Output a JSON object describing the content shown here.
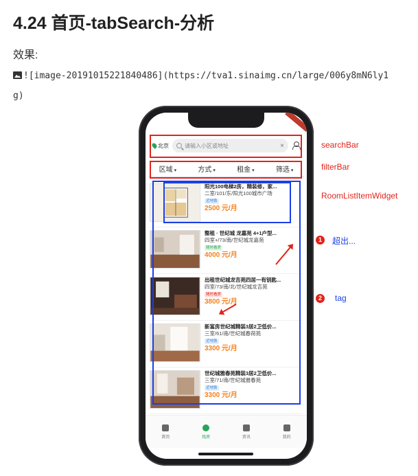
{
  "heading": "4.24 首页-tabSearch-分析",
  "effect_label": "效果:",
  "markdown_line": "![image-20191015221840486](https://tva1.sinaimg.cn/large/006y8mN6ly1",
  "markdown_tail": "g)",
  "phone": {
    "search_bar": {
      "city": "北京",
      "placeholder": "请输入小区或地址",
      "clear_symbol": "×"
    },
    "filter_bar": [
      "区域",
      "方式",
      "租金",
      "筛选"
    ],
    "rooms": [
      {
        "title": "阳光100电梯2房，精装修，家...",
        "subtitle": "二室/101/东/阳光100城市广场",
        "tag": "近地铁",
        "price": "2500 元/月"
      },
      {
        "title": "整租 · 世纪城 龙嘉苑 4+1户型...",
        "subtitle": "四室+/73/南/世纪城龙嘉苑",
        "tag": "随时看房",
        "price": "4000 元/月"
      },
      {
        "title": "出租世纪城龙吉苑四居一有钥匙...",
        "subtitle": "四室/73/南/北/世纪城龙吉苑",
        "tag": "随时看房",
        "price": "3800 元/月"
      },
      {
        "title": "新富房世纪城精装3居2卫低价...",
        "subtitle": "三室/61/南/世纪城春荷苑",
        "tag": "近地铁",
        "price": "3300 元/月"
      },
      {
        "title": "世纪城雅春苑精装3居2卫低价...",
        "subtitle": "三室/71/南/世纪城雅春苑",
        "tag": "近地铁",
        "price": "3300 元/月"
      }
    ],
    "tabs": [
      {
        "label": "首页"
      },
      {
        "label": "找房"
      },
      {
        "label": "资讯"
      },
      {
        "label": "我的"
      }
    ]
  },
  "annotations": {
    "search_bar_label": "searchBar",
    "filter_bar_label": "filterBar",
    "room_item_label": "RoomListItemWidget",
    "point1_number": "1",
    "point1_text": "超出...",
    "point2_number": "2",
    "point2_text": "tag"
  },
  "colors": {
    "annotation_red": "#e2231a",
    "annotation_blue": "#1a3ee8",
    "price_orange": "#f58220",
    "accent_green": "#2aa35a"
  }
}
